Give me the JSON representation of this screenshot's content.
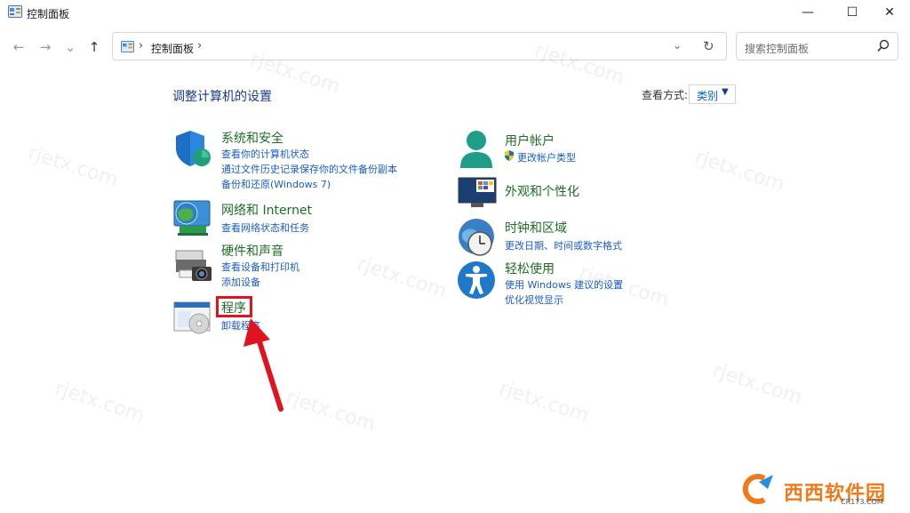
{
  "window": {
    "title": "控制面板",
    "minimize_glyph": "—",
    "maximize_glyph": "☐",
    "close_glyph": "✕"
  },
  "nav": {
    "back_glyph": "←",
    "forward_glyph": "→",
    "recent_glyph": "⌄",
    "up_glyph": "↑"
  },
  "address": {
    "path_label": "控制面板",
    "separator": "›",
    "dropdown_glyph": "⌄",
    "refresh_glyph": "↻"
  },
  "search": {
    "placeholder": "搜索控制面板"
  },
  "header": {
    "title": "调整计算机的设置",
    "view_by_label": "查看方式:",
    "view_by_value": "类别",
    "view_by_arrow": "▼"
  },
  "categories": {
    "system": {
      "title": "系统和安全",
      "links": [
        "查看你的计算机状态",
        "通过文件历史记录保存你的文件备份副本",
        "备份和还原(Windows 7)"
      ]
    },
    "network": {
      "title": "网络和 Internet",
      "links": [
        "查看网络状态和任务"
      ]
    },
    "hardware": {
      "title": "硬件和声音",
      "links": [
        "查看设备和打印机",
        "添加设备"
      ]
    },
    "programs": {
      "title": "程序",
      "links": [
        "卸载程序"
      ]
    },
    "user": {
      "title": "用户帐户",
      "links": [
        "更改帐户类型"
      ]
    },
    "appearance": {
      "title": "外观和个性化",
      "links": []
    },
    "clock": {
      "title": "时钟和区域",
      "links": [
        "更改日期、时间或数字格式"
      ]
    },
    "ease": {
      "title": "轻松使用",
      "links": [
        "使用 Windows 建议的设置",
        "优化视觉显示"
      ]
    }
  },
  "watermark_text": "rjetx.com",
  "brand": {
    "name": "西西软件园",
    "sub": "CR173.COM"
  },
  "colors": {
    "category_title": "#1e6e26",
    "link": "#1a5cc8",
    "header": "#1a3a8a",
    "highlight": "#e0141e",
    "arrow": "#e0141e"
  }
}
